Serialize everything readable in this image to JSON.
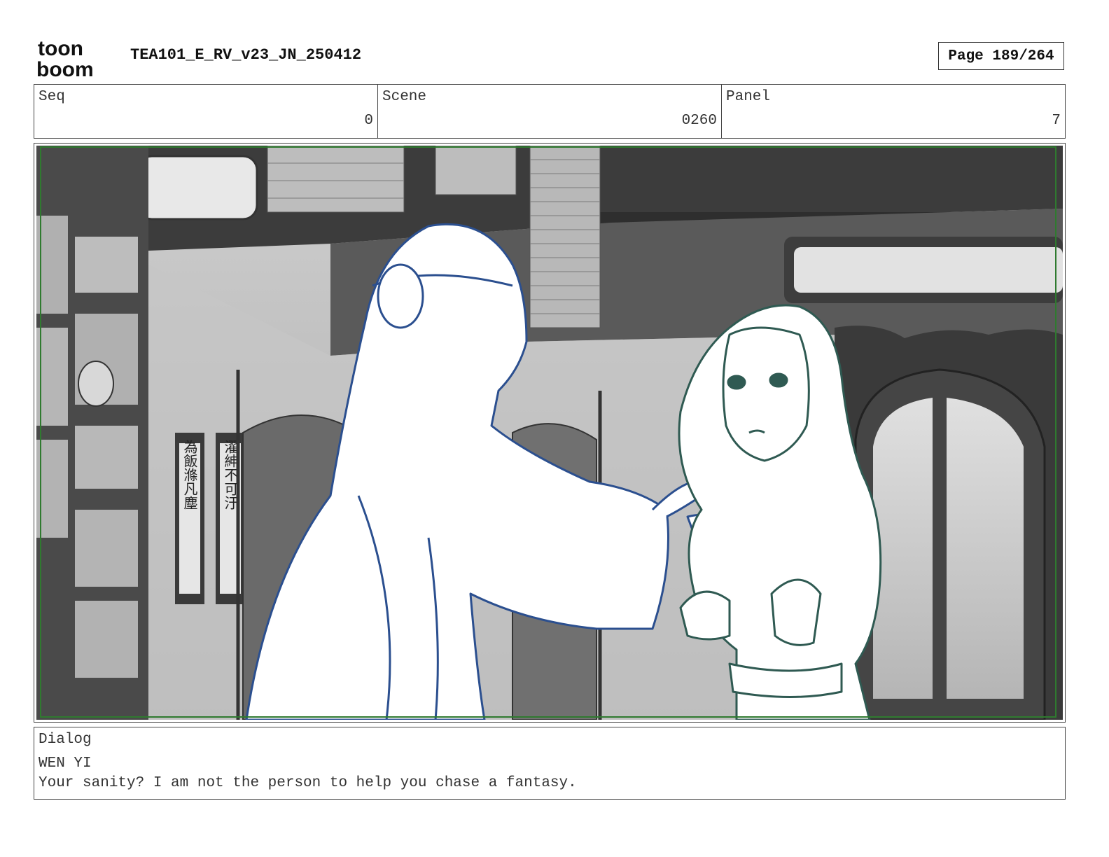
{
  "header": {
    "logo_top": "toon",
    "logo_bottom": "boom",
    "title": "TEA101_E_RV_v23_JN_250412",
    "page": "Page 189/264"
  },
  "info": {
    "seq_label": "Seq",
    "seq_value": "0",
    "scene_label": "Scene",
    "scene_value": "0260",
    "panel_label": "Panel",
    "panel_value": "7"
  },
  "panel": {
    "scroll_left_text": "為飯滌凡塵",
    "scroll_right_text": "濯紳不可汙",
    "colors": {
      "left_character_line": "#2b4f8f",
      "right_character_line": "#2f5a52",
      "safe_frame": "#2f7a2f"
    }
  },
  "dialog": {
    "label": "Dialog",
    "speaker": "WEN YI",
    "line": "Your sanity? I am not the person to help you chase a fantasy."
  }
}
